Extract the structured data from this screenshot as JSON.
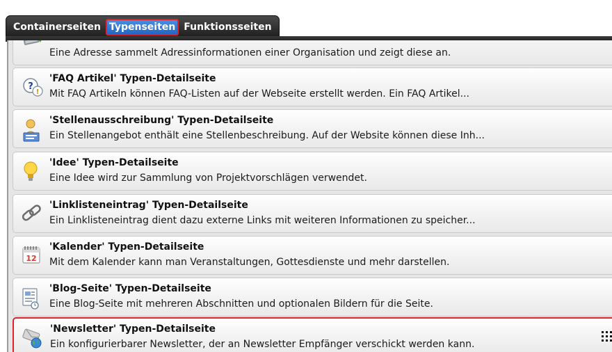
{
  "tabs": [
    {
      "label": "Containerseiten"
    },
    {
      "label": "Typenseiten"
    },
    {
      "label": "Funktionsseiten"
    }
  ],
  "items": [
    {
      "title": "",
      "desc": "Eine Adresse sammelt Adressinformationen einer Organisation und zeigt diese an."
    },
    {
      "title": "'FAQ Artikel' Typen-Detailseite",
      "desc": "Mit FAQ Artikeln können FAQ-Listen auf der Webseite erstellt werden. Ein FAQ Artikel..."
    },
    {
      "title": "'Stellenausschreibung' Typen-Detailseite",
      "desc": "Ein Stellenangebot enthält eine Stellenbeschreibung. Auf der Website können diese Inh..."
    },
    {
      "title": "'Idee' Typen-Detailseite",
      "desc": "Eine Idee wird zur Sammlung von Projektvorschlägen verwendet."
    },
    {
      "title": "'Linklisteneintrag' Typen-Detailseite",
      "desc": "Ein Linklisteneintrag dient dazu externe Links mit weiteren Informationen zu speicher..."
    },
    {
      "title": "'Kalender' Typen-Detailseite",
      "desc": "Mit dem Kalender kann man Veranstaltungen, Gottesdienste und mehr darstellen."
    },
    {
      "title": "'Blog-Seite' Typen-Detailseite",
      "desc": "Eine Blog-Seite mit mehreren Abschnitten und optionalen Bildern für die Seite."
    },
    {
      "title": "'Newsletter' Typen-Detailseite",
      "desc": "Ein konfigurierbarer Newsletter, der an Newsletter Empfänger verschickt werden kann."
    }
  ],
  "icons": {
    "calendar_day": "12"
  },
  "colors": {
    "active_tab": "#2e74d0",
    "selection_border": "#e0232b"
  }
}
